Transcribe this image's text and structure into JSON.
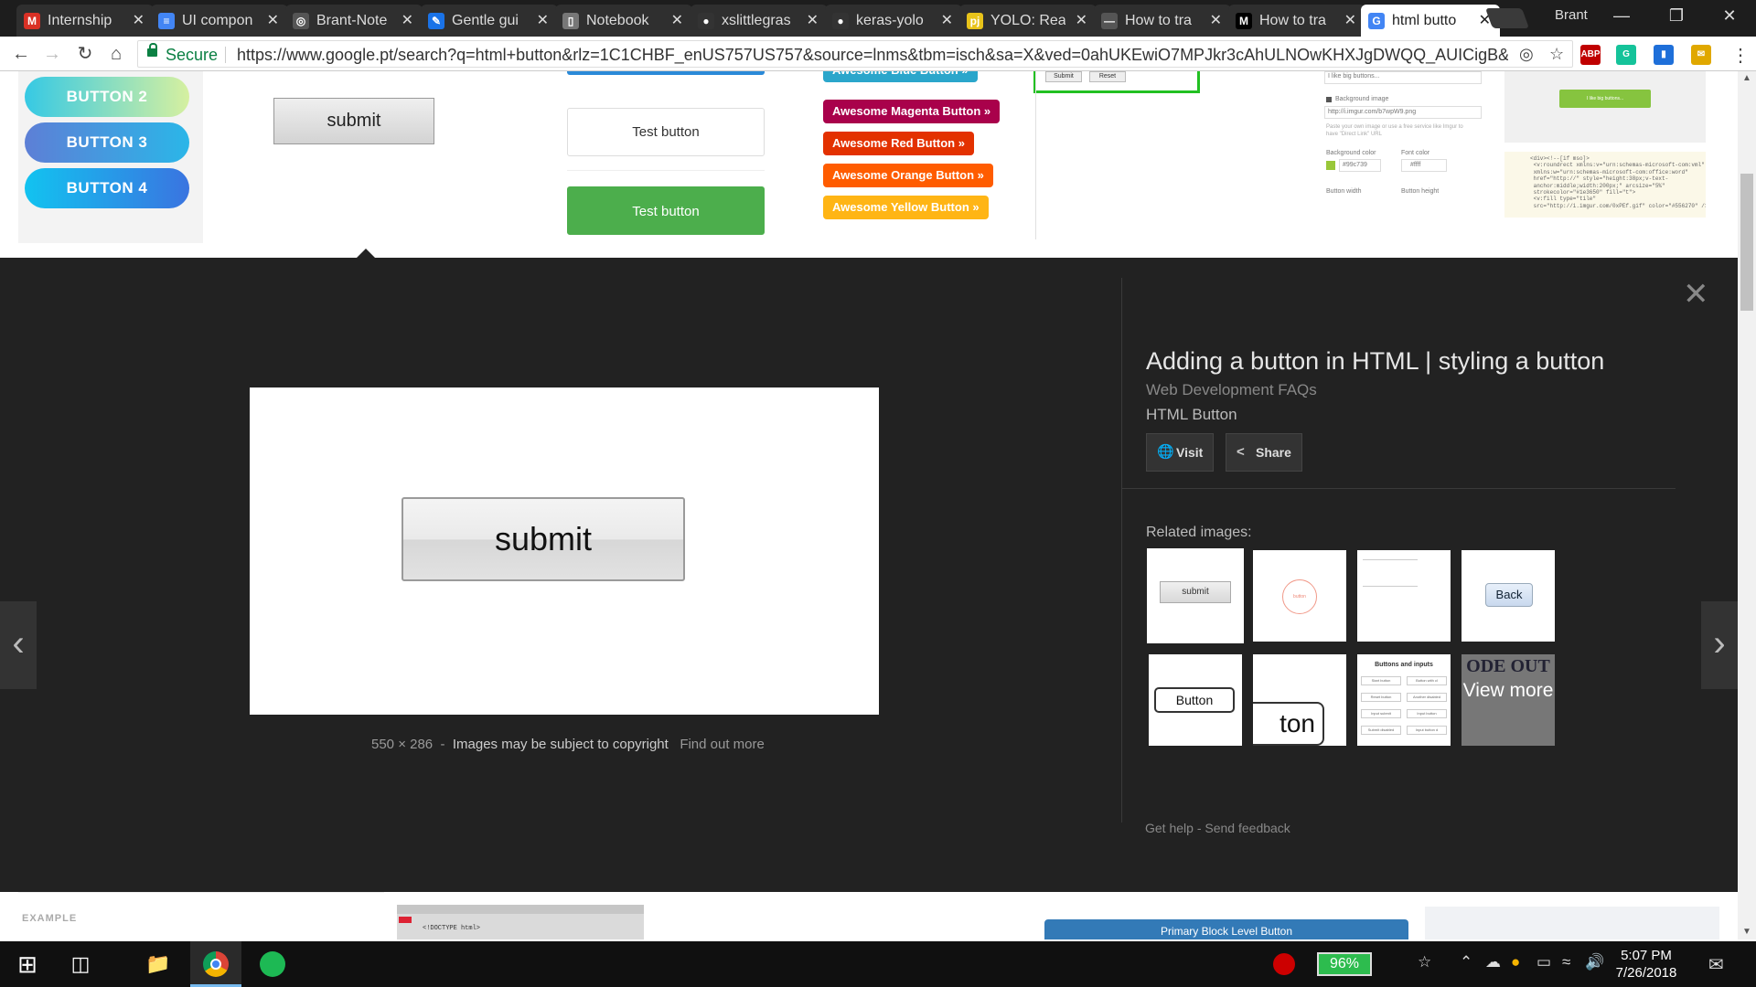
{
  "browser": {
    "tabs": [
      {
        "title": "Internship",
        "icon": "gmail-icon",
        "icon_glyph": "M",
        "icon_color": "#d93025"
      },
      {
        "title": "UI compon",
        "icon": "docs-icon",
        "icon_glyph": "≡",
        "icon_color": "#4285f4"
      },
      {
        "title": "Brant-Note",
        "icon": "jupyter-icon",
        "icon_glyph": "◎",
        "icon_color": "#555555"
      },
      {
        "title": "Gentle gui",
        "icon": "blog-icon",
        "icon_glyph": "✎",
        "icon_color": "#1a73e8"
      },
      {
        "title": "Notebook",
        "icon": "page-icon",
        "icon_glyph": "▯",
        "icon_color": "#777777"
      },
      {
        "title": "xslittlegras",
        "icon": "github-icon",
        "icon_glyph": "●",
        "icon_color": "#333333"
      },
      {
        "title": "keras-yolo",
        "icon": "github-icon",
        "icon_glyph": "●",
        "icon_color": "#333333"
      },
      {
        "title": "YOLO: Real",
        "icon": "pj-icon",
        "icon_glyph": "pj",
        "icon_color": "#e8c31a"
      },
      {
        "title": "How to tra",
        "icon": "page-icon",
        "icon_glyph": "—",
        "icon_color": "#555555"
      },
      {
        "title": "How to tra",
        "icon": "medium-icon",
        "icon_glyph": "M",
        "icon_color": "#000000"
      },
      {
        "title": "html butto",
        "icon": "google-icon",
        "icon_glyph": "G",
        "icon_color": "#4285f4",
        "active": true
      }
    ],
    "profile_name": "Brant",
    "secure_label": "Secure",
    "url": "https://www.google.pt/search?q=html+button&rlz=1C1CHBF_enUS757US757&source=lnms&tbm=isch&sa=X&ved=0ahUKEwiO7MPJkr3cAhULNOwKHXJgDWQQ_AUICigB&biw=...",
    "extensions": [
      {
        "name": "adblock-icon",
        "label": "ABP",
        "color": "#c00000"
      },
      {
        "name": "grammarly-icon",
        "label": "G",
        "color": "#15c39a"
      },
      {
        "name": "bookmark-ext-icon",
        "label": "▮",
        "color": "#1e6fd9"
      },
      {
        "name": "notes-ext-icon",
        "label": "✉",
        "color": "#e0a800"
      }
    ]
  },
  "strip": {
    "pill_buttons": [
      {
        "label": "BUTTON 2",
        "color_from": "#36c9e4",
        "color_to": "#d6f0a0"
      },
      {
        "label": "BUTTON 3",
        "color_from": "#5d7fd6",
        "color_to": "#2bb6e8"
      },
      {
        "label": "BUTTON 4",
        "color_from": "#12c3f0",
        "color_to": "#3a74e0"
      }
    ],
    "submit_label": "submit",
    "test_button_label": "Test button",
    "test_button_green_label": "Test button",
    "awesome_buttons": [
      {
        "label": "Awesome Blue Button »",
        "color": "#2ba6cb"
      },
      {
        "label": "Awesome Magenta Button »",
        "color": "#a9014b"
      },
      {
        "label": "Awesome Red Button »",
        "color": "#e33100"
      },
      {
        "label": "Awesome Orange Button »",
        "color": "#ff5c00"
      },
      {
        "label": "Awesome Yellow Button »",
        "color": "#ffb515"
      }
    ],
    "form_buttons": [
      "Submit",
      "Reset"
    ],
    "form_inputs": [
      "I like big buttons...",
      "http://i.imgur.com/b7wpW9.png"
    ],
    "form_labels": [
      "Background image",
      "Background color",
      "Font color",
      "Button width",
      "Button height",
      "Paste your own image or use a free service like Imgur to",
      "have \"Direct Link\" URL"
    ],
    "form_values": [
      "#99c739",
      "#ffff"
    ],
    "green_small_label": "I like big buttons...",
    "code_snippet": "<div><!--[if mso]>\n <v:roundrect xmlns:v=\"urn:schemas-microsoft-com:vml\"\n xmlns:w=\"urn:schemas-microsoft-com:office:word\"\n href=\"http://\" style=\"height:38px;v-text-\n anchor:middle;width:200px;\" arcsize=\"5%\"\n strokecolor=\"#1e3650\" fill=\"t\">\n <v:fill type=\"tile\"\n src=\"http://i.imgur.com/0xPEf.gif\" color=\"#556270\" />"
  },
  "preview": {
    "button_label": "submit",
    "dimensions": "550 × 286",
    "copyright_note": "Images may be subject to copyright",
    "find_out_more": "Find out more",
    "title": "Adding a button in HTML | styling a button",
    "source": "Web Development FAQs",
    "subtitle": "HTML Button",
    "visit_label": "Visit",
    "share_label": "Share",
    "related_label": "Related images:",
    "related": [
      {
        "label": "submit"
      },
      {
        "label": "button"
      },
      {
        "label": ""
      },
      {
        "label": "Back"
      },
      {
        "label": "Button"
      },
      {
        "label": "ton"
      },
      {
        "label": "Buttons and inputs"
      },
      {
        "label": "View more",
        "overlay": "ODE OUT"
      }
    ],
    "related_small_labels": [
      "Start button",
      "Button with cl",
      "Reset button",
      "Another disabled",
      "Input submit",
      "Input button",
      "Submit disabled",
      "Input button d"
    ],
    "help_label": "Get help",
    "feedback_label": "Send feedback",
    "link_sep": "-"
  },
  "below": {
    "example_label": "EXAMPLE",
    "code_line": "<!DOCTYPE html>",
    "primary_button_label": "Primary Block Level Button"
  },
  "taskbar": {
    "battery": "96%",
    "time": "5:07 PM",
    "date": "7/26/2018"
  }
}
